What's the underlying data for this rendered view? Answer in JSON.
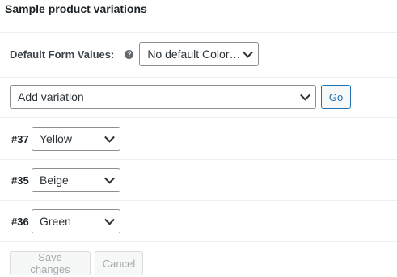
{
  "panel": {
    "title": "Sample product variations"
  },
  "defaults": {
    "label": "Default Form Values:",
    "help_icon": "?",
    "select_value": "No default Color…"
  },
  "add_variation": {
    "select_value": "Add variation",
    "go_label": "Go"
  },
  "variations": [
    {
      "id": "#37",
      "value": "Yellow"
    },
    {
      "id": "#35",
      "value": "Beige"
    },
    {
      "id": "#36",
      "value": "Green"
    }
  ],
  "footer": {
    "save_label": "Save changes",
    "cancel_label": "Cancel"
  }
}
